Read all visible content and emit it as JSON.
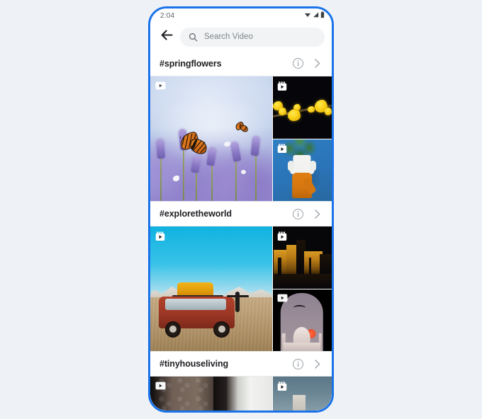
{
  "status_bar": {
    "time": "2:04",
    "icons": [
      "wifi-icon",
      "signal-icon",
      "battery-icon"
    ]
  },
  "header": {
    "back_icon": "back-arrow-icon",
    "search": {
      "icon": "search-icon",
      "placeholder": "Search Video",
      "value": ""
    }
  },
  "sections": [
    {
      "hashtag": "#springflowers",
      "info_icon": "info-icon",
      "chevron_icon": "chevron-right-icon",
      "tiles": [
        {
          "alt": "Monarch butterfly on lavender flowers",
          "badge": "video-badge"
        },
        {
          "alt": "Yellow forsythia blossoms on black background",
          "badge": "multi-video-badge"
        },
        {
          "alt": "Person in orange pants holding a potted plant over their head against blue wall",
          "badge": "multi-video-badge"
        }
      ]
    },
    {
      "hashtag": "#exploretheworld",
      "info_icon": "info-icon",
      "chevron_icon": "chevron-right-icon",
      "tiles": [
        {
          "alt": "Red SUV with yellow roof luggage in a desert under cyan sky",
          "badge": "multi-video-badge"
        },
        {
          "alt": "Illuminated ancient temple ruins at night",
          "badge": "multi-video-badge"
        },
        {
          "alt": "Taj Mahal at sunset framed by an arch",
          "badge": "video-badge"
        }
      ]
    },
    {
      "hashtag": "#tinyhouseliving",
      "info_icon": "info-icon",
      "chevron_icon": "chevron-right-icon",
      "tiles": [
        {
          "alt": "Dark interior with patterned wallpaper and bright window",
          "badge": "video-badge"
        },
        {
          "alt": "Blue-gray room interior with light box",
          "badge": "multi-video-badge"
        }
      ]
    }
  ],
  "colors": {
    "device_border": "#1a73e8",
    "page_background": "#eef2f7",
    "search_field": "#f1f3f4",
    "placeholder_text": "#80868b",
    "hashtag_text": "#202124",
    "divider": "#e8eaed"
  }
}
